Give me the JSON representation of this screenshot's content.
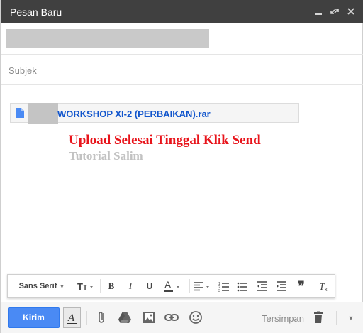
{
  "window": {
    "title": "Pesan Baru",
    "controls": [
      "minimize-icon",
      "expand-icon",
      "close-icon"
    ]
  },
  "recipients": {
    "to_value": ""
  },
  "subject": {
    "placeholder": "Subjek",
    "value": ""
  },
  "attachment": {
    "icon": "document-icon",
    "filename": "WORKSHOP XI-2 (PERBAIKAN).rar"
  },
  "overlay": {
    "line1": "Upload Selesai Tinggal Klik Send",
    "line2": "Tutorial Salim",
    "line1_color": "#e8141b",
    "line2_color": "#c2c2c2"
  },
  "format_toolbar": {
    "font_family": "Sans Serif",
    "items": [
      "font-size-icon",
      "bold-icon",
      "italic-icon",
      "underline-icon",
      "text-color-icon",
      "align-icon",
      "numbered-list-icon",
      "bulleted-list-icon",
      "indent-less-icon",
      "indent-more-icon",
      "quote-icon",
      "remove-formatting-icon"
    ]
  },
  "bottom_bar": {
    "send_label": "Kirim",
    "saved_label": "Tersimpan",
    "icons": [
      "formatting-icon",
      "attach-icon",
      "drive-icon",
      "photo-icon",
      "link-icon",
      "emoji-icon",
      "trash-icon",
      "more-options-icon"
    ]
  },
  "colors": {
    "title_bar": "#404040",
    "send_button": "#4a8af4",
    "attachment_link": "#1155cc"
  }
}
